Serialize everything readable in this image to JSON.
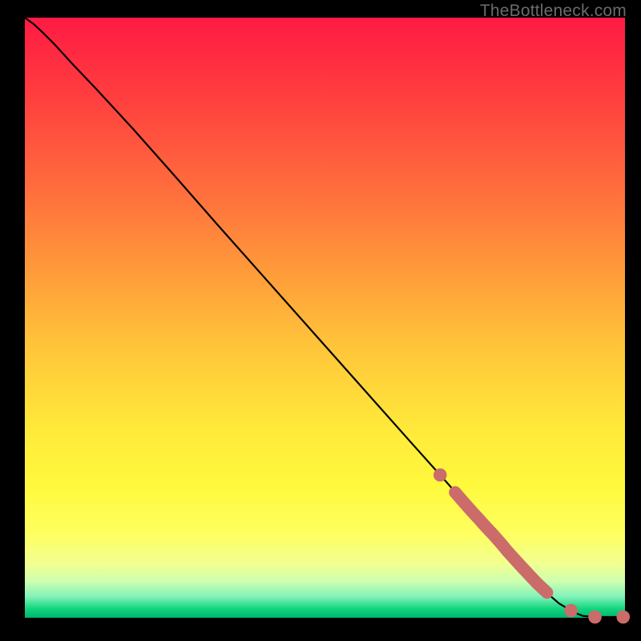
{
  "watermark": "TheBottleneck.com",
  "colors": {
    "dot": "#cb6c6a",
    "curve": "#000000",
    "background_frame": "#000000"
  },
  "chart_data": {
    "type": "line",
    "title": "",
    "xlabel": "",
    "ylabel": "",
    "xlim": [
      0,
      100
    ],
    "ylim": [
      0,
      100
    ],
    "grid": false,
    "legend": false,
    "note": "No axis tick labels are visible; x and y are normalized to plot width/height (0 = left/bottom, 100 = right/top). Points are estimated from pixel positions.",
    "series": [
      {
        "name": "curve",
        "style": "solid-black",
        "x": [
          0.0,
          1.5,
          3.0,
          5.0,
          8.0,
          12.0,
          18.0,
          25.0,
          32.0,
          40.0,
          48.0,
          56.0,
          64.0,
          70.0,
          76.0,
          82.0,
          86.0,
          89.0,
          91.5,
          93.0,
          95.0,
          97.0,
          99.7
        ],
        "y": [
          100.0,
          98.9,
          97.5,
          95.5,
          92.2,
          88.0,
          81.5,
          73.6,
          65.6,
          56.6,
          47.6,
          38.6,
          29.6,
          22.9,
          16.1,
          9.4,
          5.0,
          2.4,
          0.9,
          0.3,
          0.13,
          0.13,
          0.13
        ]
      },
      {
        "name": "highlighted-markers",
        "style": "salmon-dots-on-curve",
        "x": [
          69.2,
          71.7,
          73.0,
          74.5,
          75.8,
          76.5,
          78.0,
          79.5,
          80.4,
          82.5,
          83.8,
          85.3,
          87.0,
          91.0,
          95.0,
          99.7
        ],
        "y": [
          23.8,
          20.9,
          19.4,
          17.7,
          16.3,
          15.5,
          13.9,
          12.2,
          11.1,
          8.8,
          7.4,
          5.8,
          4.2,
          1.2,
          0.13,
          0.13
        ]
      }
    ]
  }
}
